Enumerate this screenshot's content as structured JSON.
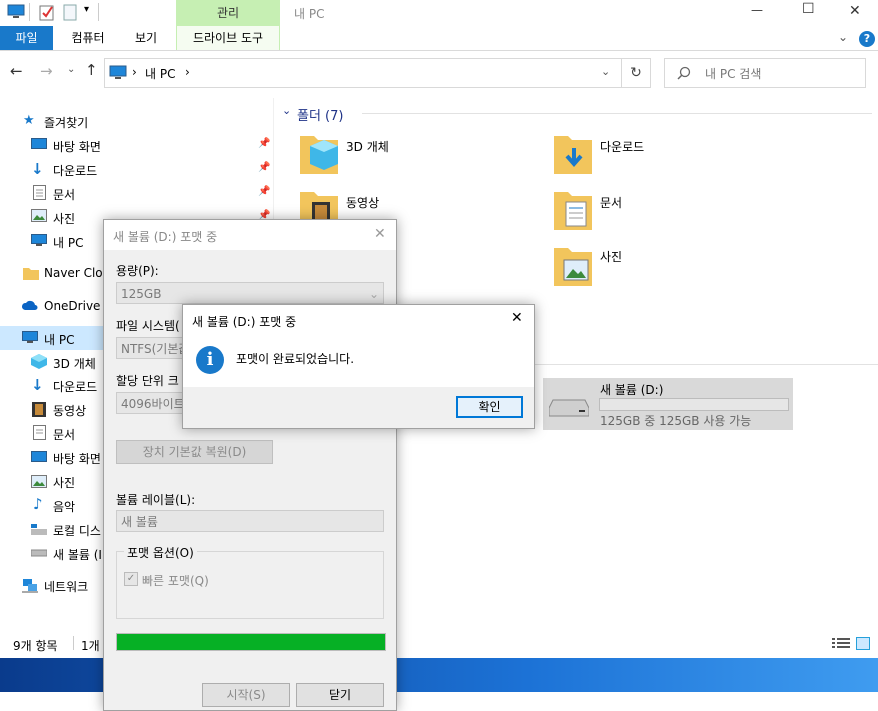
{
  "window": {
    "title": "내 PC",
    "ribbon_context_label": "관리",
    "minimize": "—",
    "maximize": "☐",
    "close": "✕"
  },
  "ribbon": {
    "tabs": [
      "파일",
      "컴퓨터",
      "보기",
      "드라이브 도구"
    ],
    "help": "?"
  },
  "address": {
    "path_root": "내 PC",
    "search_placeholder": "내 PC 검색"
  },
  "sidebar": {
    "quick_access": "즐겨찾기",
    "pinned": [
      "바탕 화면",
      "다운로드",
      "문서",
      "사진",
      "내 PC"
    ],
    "naver": "Naver Clou",
    "onedrive": "OneDrive",
    "this_pc": "내 PC",
    "pc_items": [
      "3D 개체",
      "다운로드",
      "동영상",
      "문서",
      "바탕 화면",
      "사진",
      "음악",
      "로컬 디스",
      "새 볼륨 (I"
    ],
    "network": "네트워크"
  },
  "main": {
    "folders_header": "폴더 (7)",
    "folders": [
      "3D 개체",
      "다운로드",
      "동영상",
      "문서",
      "사진"
    ],
    "drive": {
      "name": "새 볼륨 (D:)",
      "usage": "125GB 중 125GB 사용 가능",
      "fill_fraction": 0.0
    }
  },
  "statusbar": {
    "count": "9개 항목",
    "selected": "1개"
  },
  "format_dialog": {
    "title": "새 볼륨 (D:) 포맷 중",
    "capacity_label": "용량(P):",
    "capacity_value": "125GB",
    "filesystem_label": "파일 시스템(",
    "filesystem_value": "NTFS(기본값",
    "allocation_label": "할당 단위 크",
    "allocation_value": "4096바이트",
    "restore_button": "장치 기본값 복원(D)",
    "volume_label": "볼륨 레이블(L):",
    "volume_value": "새 볼륨",
    "options_label": "포맷 옵션(O)",
    "quick_format": "빠른 포맷(Q)",
    "progress_fraction": 1.0,
    "start_button": "시작(S)",
    "close_button": "닫기"
  },
  "message_box": {
    "title": "새 볼륨 (D:) 포맷 중",
    "message": "포맷이 완료되었습니다.",
    "ok_button": "확인",
    "info_glyph": "i"
  },
  "colors": {
    "accent": "#1979ca",
    "selection": "#cce8ff",
    "progress": "#06b025",
    "context_tab": "#c6efb3"
  }
}
